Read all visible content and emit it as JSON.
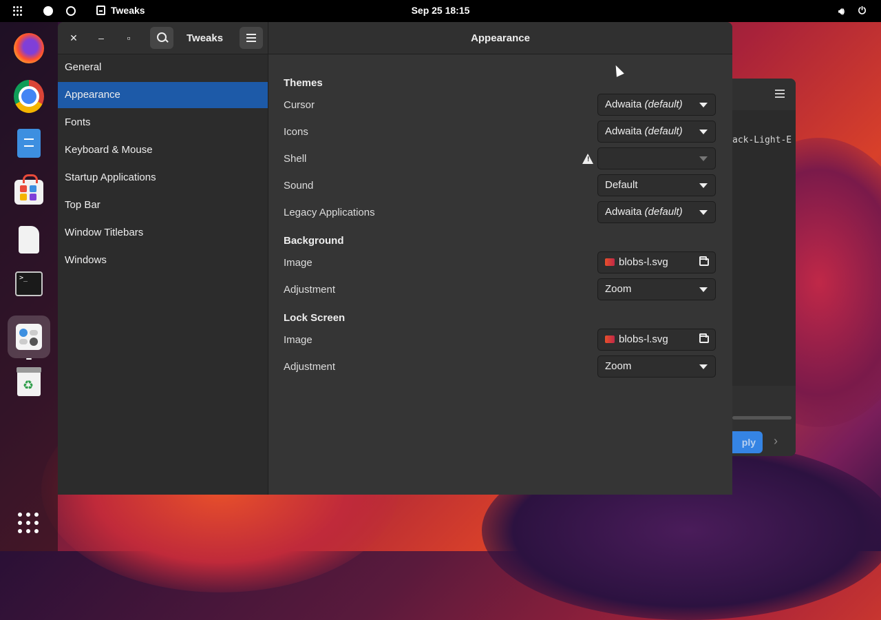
{
  "topbar": {
    "app_name": "Tweaks",
    "clock": "Sep 25  18:15"
  },
  "dock": {
    "items": [
      "firefox-icon",
      "chrome-icon",
      "files-icon",
      "software-store-icon",
      "text-editor-icon",
      "terminal-icon",
      "tweaks-icon",
      "trash-icon"
    ],
    "terminal_prompt": ">_"
  },
  "background_window": {
    "snippet": "ack-Light-E",
    "apply_label": "ply"
  },
  "window": {
    "title": "Tweaks",
    "page_title": "Appearance"
  },
  "sidebar": {
    "items": [
      {
        "label": "General"
      },
      {
        "label": "Appearance"
      },
      {
        "label": "Fonts"
      },
      {
        "label": "Keyboard & Mouse"
      },
      {
        "label": "Startup Applications"
      },
      {
        "label": "Top Bar"
      },
      {
        "label": "Window Titlebars"
      },
      {
        "label": "Windows"
      }
    ],
    "selected": "Appearance"
  },
  "themes": {
    "title": "Themes",
    "cursor": {
      "label": "Cursor",
      "value": "Adwaita",
      "suffix": "(default)"
    },
    "icons": {
      "label": "Icons",
      "value": "Adwaita",
      "suffix": "(default)"
    },
    "shell": {
      "label": "Shell",
      "value": ""
    },
    "sound": {
      "label": "Sound",
      "value": "Default"
    },
    "legacy": {
      "label": "Legacy Applications",
      "value": "Adwaita",
      "suffix": "(default)"
    }
  },
  "background": {
    "title": "Background",
    "image": {
      "label": "Image",
      "value": "blobs-l.svg"
    },
    "adjustment": {
      "label": "Adjustment",
      "value": "Zoom"
    }
  },
  "lock_screen": {
    "title": "Lock Screen",
    "image": {
      "label": "Image",
      "value": "blobs-l.svg"
    },
    "adjustment": {
      "label": "Adjustment",
      "value": "Zoom"
    }
  }
}
